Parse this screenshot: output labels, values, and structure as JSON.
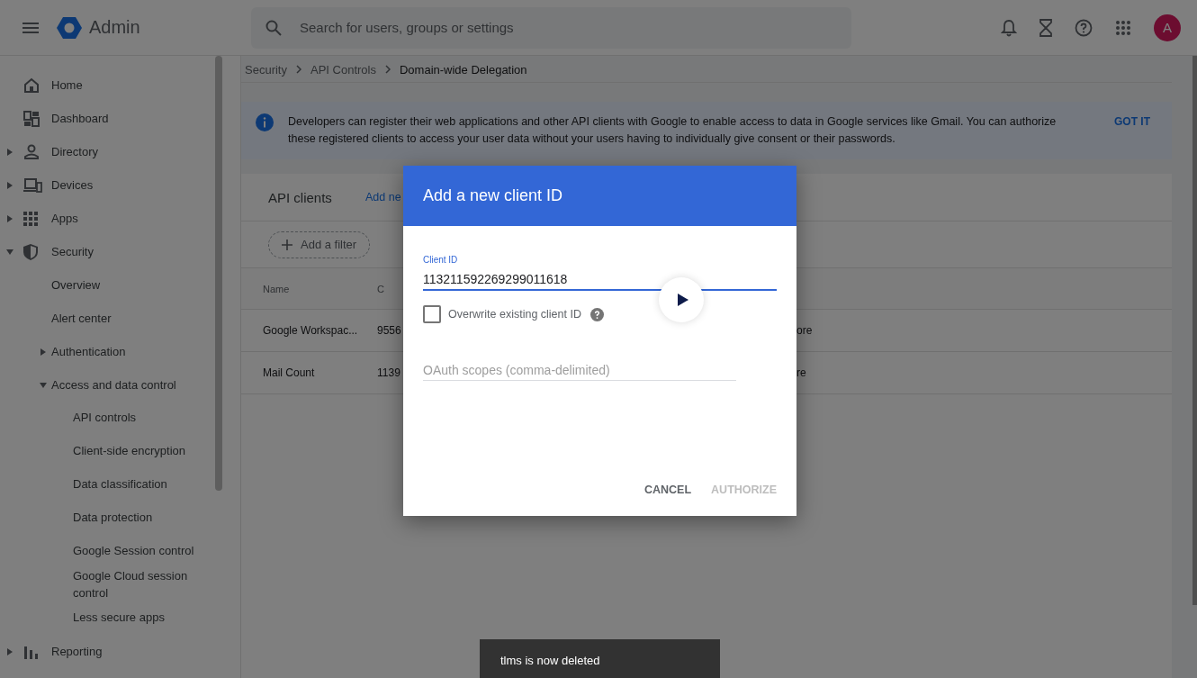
{
  "topbar": {
    "product": "Admin",
    "search": {
      "placeholder": "Search for users, groups or settings"
    },
    "avatar": "A"
  },
  "sidebar": {
    "items": [
      {
        "label": "Home",
        "kind": "home"
      },
      {
        "label": "Dashboard",
        "kind": "dashboard"
      },
      {
        "label": "Directory",
        "kind": "directory",
        "expanded": false
      },
      {
        "label": "Devices",
        "kind": "devices",
        "expanded": false
      },
      {
        "label": "Apps",
        "kind": "apps",
        "expanded": false
      },
      {
        "label": "Security",
        "kind": "security",
        "expanded": true,
        "children": [
          {
            "label": "Overview"
          },
          {
            "label": "Alert center"
          },
          {
            "label": "Authentication",
            "expanded": false
          },
          {
            "label": "Access and data control",
            "expanded": true,
            "children": [
              {
                "label": "API controls"
              },
              {
                "label": "Client-side encryption"
              },
              {
                "label": "Data classification"
              },
              {
                "label": "Data protection"
              },
              {
                "label": "Google Session control"
              },
              {
                "label": "Google Cloud session control"
              },
              {
                "label": "Less secure apps"
              }
            ]
          }
        ]
      },
      {
        "label": "Reporting",
        "kind": "reporting",
        "expanded": false
      }
    ]
  },
  "breadcrumb": [
    "Security",
    "API Controls",
    "Domain-wide Delegation"
  ],
  "banner": {
    "text": "Developers can register their web applications and other API clients with Google to enable access to data in Google services like Gmail. You can authorize these registered clients to access your user data without your users having to individually give consent or their passwords.",
    "action": "GOT IT"
  },
  "card": {
    "title": "API clients",
    "link": "Add ne",
    "filter": "Add a filter",
    "table": {
      "columns": [
        "Name",
        "C"
      ],
      "rows": [
        [
          "Google Workspac...",
          "9556",
          "ore"
        ],
        [
          "Mail Count",
          "1139",
          "re"
        ]
      ]
    }
  },
  "dialog": {
    "title": "Add a new client ID",
    "client_id": {
      "label": "Client ID",
      "value": "113211592269299011618"
    },
    "overwrite": {
      "label": "Overwrite existing client ID",
      "checked": false
    },
    "scopes": {
      "placeholder": "OAuth scopes (comma-delimited)"
    },
    "buttons": [
      {
        "label": "CANCEL",
        "disabled": false
      },
      {
        "label": "AUTHORIZE",
        "disabled": true
      }
    ]
  },
  "snackbar": "tlms is now deleted"
}
